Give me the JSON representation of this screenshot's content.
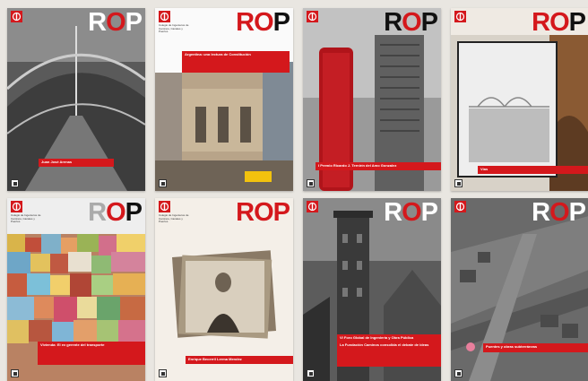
{
  "covers": [
    {
      "masthead": {
        "r": "R",
        "o": "O",
        "p": "P"
      },
      "band_title": "Juan José Arenas",
      "band_sub": "",
      "theme": "dark"
    },
    {
      "masthead": {
        "r": "R",
        "o": "O",
        "p": "P"
      },
      "band_title": "Argentina: una lectura de Constitución",
      "band_sub": "",
      "theme": "light"
    },
    {
      "masthead": {
        "r": "R",
        "o": "O",
        "p": "P"
      },
      "band_title": "I Premio Ricardo J. Ternirín del Amo Gonzalez",
      "band_sub": "",
      "theme": "light"
    },
    {
      "masthead": {
        "r": "R",
        "o": "O",
        "p": "P"
      },
      "band_title": "Vías",
      "band_sub": "",
      "theme": "light"
    },
    {
      "masthead": {
        "r": "R",
        "o": "O",
        "p": "P"
      },
      "band_title": "Vivienda: El ex gerente del transporte",
      "band_sub": "",
      "theme": "light"
    },
    {
      "masthead": {
        "r": "R",
        "o": "O",
        "p": "P"
      },
      "band_title": "Enrique Becerril Lerma Mendez",
      "band_sub": "",
      "theme": "light"
    },
    {
      "masthead": {
        "r": "R",
        "o": "O",
        "p": "P"
      },
      "band_title": "VI Foro Global de Ingeniería y Obra Pública",
      "band_sub": "La Fundación Caminos consolida el debate de ideas",
      "theme": "dark"
    },
    {
      "masthead": {
        "r": "R",
        "o": "O",
        "p": "P"
      },
      "band_title": "Puentes y obras subterráneas",
      "band_sub": "",
      "theme": "dark"
    }
  ],
  "org_line": "Colegio de Ingenieros de Caminos, Canales y Puertos",
  "colors": {
    "brand_red": "#d4181c"
  }
}
